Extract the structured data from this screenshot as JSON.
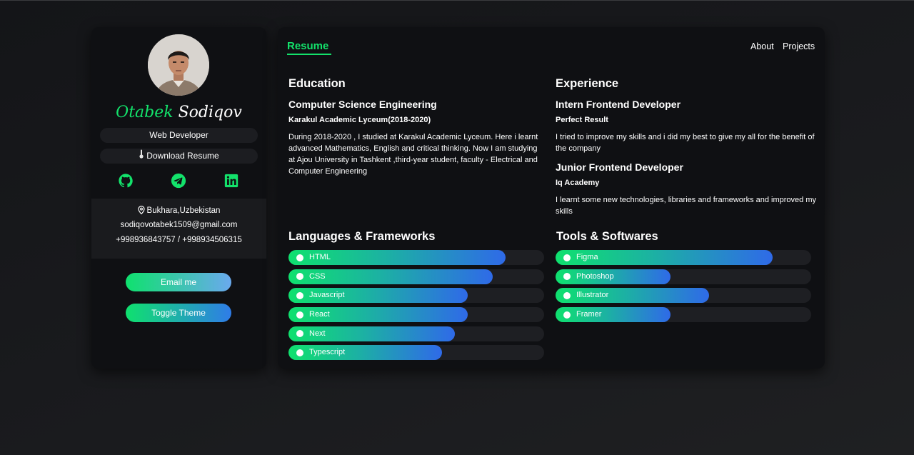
{
  "profile": {
    "first_name": "Otabek",
    "last_name": "Sodiqov",
    "role": "Web Developer",
    "download_label": "Download Resume",
    "location": "Bukhara,Uzbekistan",
    "email": "sodiqovotabek1509@gmail.com",
    "phone": "+998936843757 / +998934506315",
    "email_button": "Email me",
    "theme_button": "Toggle Theme",
    "social_icons": [
      "github-icon",
      "telegram-icon",
      "linkedin-icon"
    ]
  },
  "nav": {
    "active_tab": "Resume",
    "links": [
      "About",
      "Projects"
    ]
  },
  "education": {
    "title": "Education",
    "items": [
      {
        "title": "Computer Science Engineering",
        "org": "Karakul Academic Lyceum(2018-2020)",
        "desc": "During 2018-2020 , I studied at Karakul Academic Lyceum. Here i learnt advanced Mathematics, English and critical thinking. Now I am studying at Ajou University in Tashkent ,third-year student, faculty - Electrical and Computer Engineering"
      }
    ]
  },
  "experience": {
    "title": "Experience",
    "items": [
      {
        "title": "Intern Frontend Developer",
        "org": "Perfect Result",
        "desc": "I tried to improve my skills and i did my best to give my all for the benefit of the company"
      },
      {
        "title": "Junior Frontend Developer",
        "org": "Iq Academy",
        "desc": "I learnt some new technologies, libraries and frameworks and improved my skills"
      }
    ]
  },
  "languages": {
    "title": "Languages & Frameworks",
    "skills": [
      {
        "name": "HTML",
        "level": 0.85
      },
      {
        "name": "CSS",
        "level": 0.8
      },
      {
        "name": "Javascript",
        "level": 0.7
      },
      {
        "name": "React",
        "level": 0.7
      },
      {
        "name": "Next",
        "level": 0.65
      },
      {
        "name": "Typescript",
        "level": 0.6
      }
    ]
  },
  "tools": {
    "title": "Tools & Softwares",
    "skills": [
      {
        "name": "Figma",
        "level": 0.85
      },
      {
        "name": "Photoshop",
        "level": 0.45
      },
      {
        "name": "Illustrator",
        "level": 0.6
      },
      {
        "name": "Framer",
        "level": 0.45
      }
    ]
  },
  "colors": {
    "accent": "#13e26b",
    "panel": "#0f1013",
    "bar_track": "#1e1f23",
    "gradient_end": "#2f6ae8"
  }
}
